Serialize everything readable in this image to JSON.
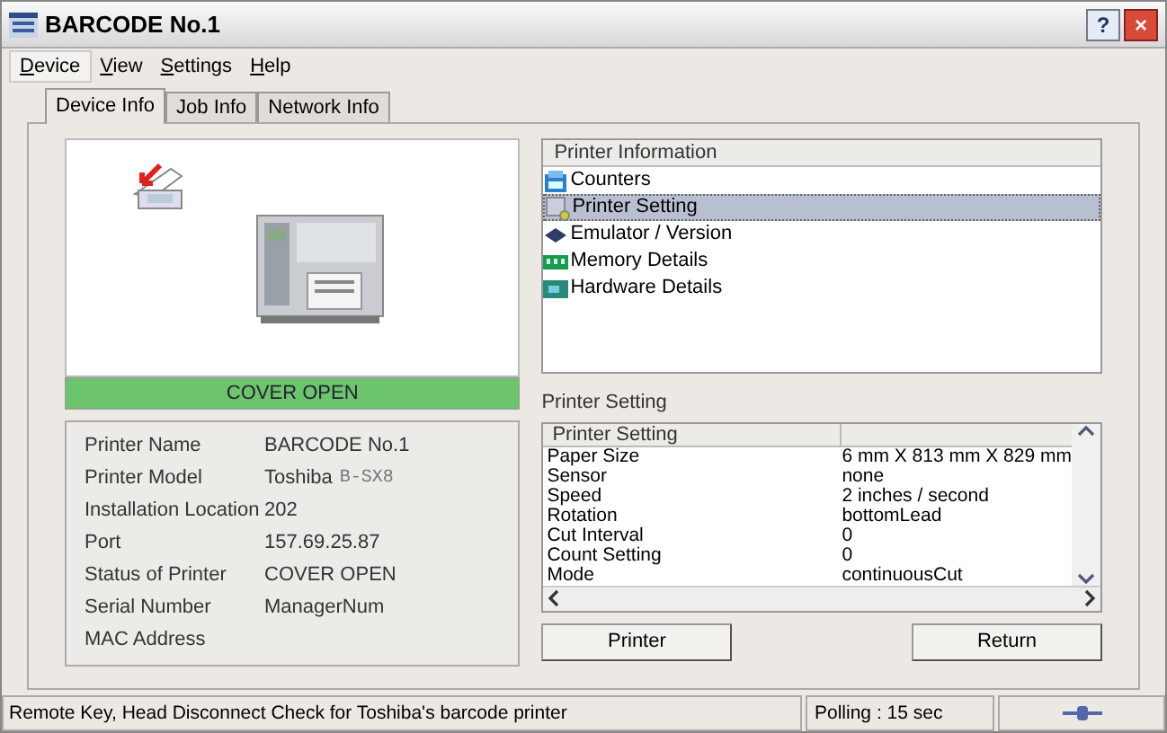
{
  "window": {
    "title": "BARCODE No.1",
    "buttons": [
      "?",
      "×"
    ]
  },
  "menu": [
    {
      "label": "Device",
      "selected": true
    },
    {
      "label": "View",
      "selected": false
    },
    {
      "label": "Settings",
      "selected": false
    },
    {
      "label": "Help",
      "selected": false
    }
  ],
  "tabs": [
    {
      "label": "Device Info",
      "selected": true
    },
    {
      "label": "Job Info",
      "selected": false
    },
    {
      "label": "Network Info",
      "selected": false
    }
  ],
  "status_banner": {
    "text": "COVER OPEN",
    "color": "#6cc46c"
  },
  "device_info": [
    {
      "label": "Printer Name",
      "value": "BARCODE No.1"
    },
    {
      "label": "Printer Model",
      "value": "Toshiba",
      "value_extra": "B-SX8"
    },
    {
      "label": "Installation Location",
      "value": "202"
    },
    {
      "label": "Port",
      "value": "157.69.25.87"
    },
    {
      "label": "Status of Printer",
      "value": "COVER OPEN"
    },
    {
      "label": "Serial Number",
      "value": "ManagerNum"
    },
    {
      "label": "MAC Address"
    }
  ],
  "tree": {
    "header": "Printer Information",
    "items": [
      {
        "label": "Counters",
        "kind": "counter",
        "selected": false
      },
      {
        "label": "Printer Setting",
        "kind": "setting",
        "selected": true
      },
      {
        "label": "Emulator / Version",
        "kind": "emulator",
        "selected": false
      },
      {
        "label": "Memory Details",
        "kind": "memory",
        "selected": false
      },
      {
        "label": "Hardware Details",
        "kind": "hardware",
        "selected": false
      }
    ]
  },
  "settings": {
    "title": "Printer Setting",
    "column_1": "Printer Setting",
    "rows": [
      {
        "name": "Paper Size",
        "value": "6 mm X 813 mm X 829 mm"
      },
      {
        "name": "Sensor",
        "value": "none"
      },
      {
        "name": "Speed",
        "value": "2 inches / second"
      },
      {
        "name": "Rotation",
        "value": "bottomLead"
      },
      {
        "name": "Cut Interval",
        "value": "0"
      },
      {
        "name": "Count Setting",
        "value": "0"
      },
      {
        "name": "Mode",
        "value": "continuousCut"
      }
    ]
  },
  "buttons": [
    "Printer",
    "Return"
  ],
  "status_bar": {
    "message": "Remote Key, Head Disconnect Check for Toshiba's barcode printer",
    "polling": "Polling : 15 sec"
  }
}
